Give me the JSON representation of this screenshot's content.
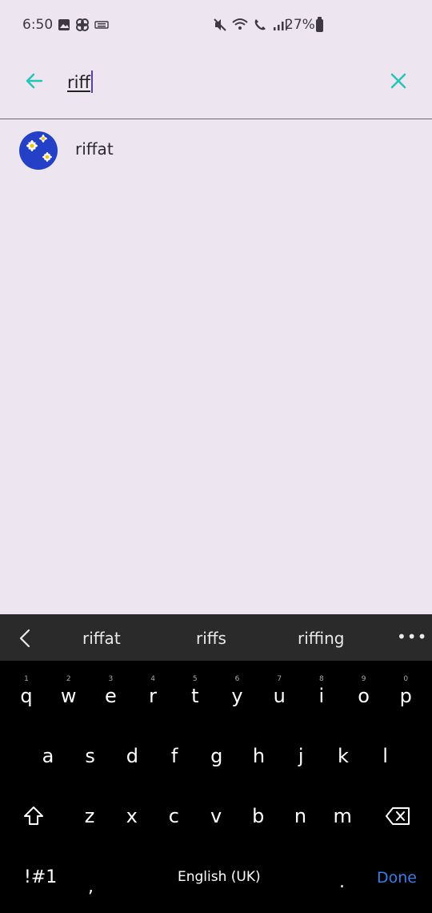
{
  "status_bar": {
    "time": "6:50",
    "battery": "27%"
  },
  "search": {
    "query": "riff"
  },
  "results": [
    {
      "name": "riffat"
    }
  ],
  "keyboard": {
    "suggestions": [
      "riffat",
      "riffs",
      "riffing"
    ],
    "row1": [
      "q",
      "w",
      "e",
      "r",
      "t",
      "y",
      "u",
      "i",
      "o",
      "p"
    ],
    "row1_hints": [
      "1",
      "2",
      "3",
      "4",
      "5",
      "6",
      "7",
      "8",
      "9",
      "0"
    ],
    "row2": [
      "a",
      "s",
      "d",
      "f",
      "g",
      "h",
      "j",
      "k",
      "l"
    ],
    "row3": [
      "z",
      "x",
      "c",
      "v",
      "b",
      "n",
      "m"
    ],
    "symbols_label": "!#1",
    "comma": ",",
    "space_label": "English (UK)",
    "period": ".",
    "done_label": "Done",
    "done_color": "#3d7be8"
  }
}
